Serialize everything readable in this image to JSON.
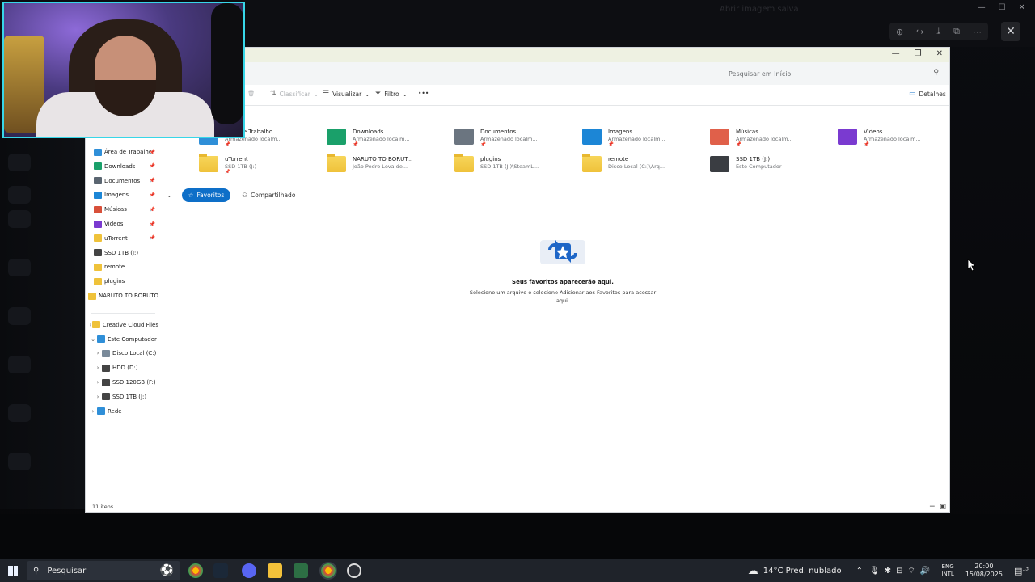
{
  "viewer": {
    "title": "Abrir imagem salva",
    "tool_icons": [
      "zoom-icon",
      "share-icon",
      "download-icon",
      "open-external-icon",
      "more-icon"
    ],
    "close_label": "✕"
  },
  "explorer": {
    "search_placeholder": "Pesquisar em Início",
    "toolbar": {
      "sort": "Classificar",
      "view": "Visualizar",
      "filter": "Filtro",
      "more": "•••",
      "details": "Detalhes"
    },
    "sidebar": {
      "pinned": [
        {
          "label": "Área de Trabalho",
          "color": "#2f8fd8",
          "pinned": true
        },
        {
          "label": "Downloads",
          "color": "#1aa06a",
          "pinned": true
        },
        {
          "label": "Documentos",
          "color": "#5a6570",
          "pinned": true
        },
        {
          "label": "Imagens",
          "color": "#1c86d6",
          "pinned": true
        },
        {
          "label": "Músicas",
          "color": "#d8503a",
          "pinned": true
        },
        {
          "label": "Vídeos",
          "color": "#7a3ad0",
          "pinned": true
        },
        {
          "label": "uTorrent",
          "color": "#efc23a",
          "pinned": true
        },
        {
          "label": "SSD 1TB (J:)",
          "color": "#444",
          "pinned": false
        },
        {
          "label": "remote",
          "color": "#efc23a",
          "pinned": false
        },
        {
          "label": "plugins",
          "color": "#efc23a",
          "pinned": false
        },
        {
          "label": "NARUTO TO BORUTO",
          "color": "#efc23a",
          "pinned": false
        }
      ],
      "tree": [
        {
          "label": "Creative Cloud Files",
          "color": "#efc23a",
          "level": 0,
          "chev": "›"
        },
        {
          "label": "Este Computador",
          "color": "#2f8fd8",
          "level": 0,
          "chev": "⌄"
        },
        {
          "label": "Disco Local (C:)",
          "color": "#7a8a9a",
          "level": 1,
          "chev": "›"
        },
        {
          "label": "HDD (D:)",
          "color": "#444",
          "level": 1,
          "chev": "›"
        },
        {
          "label": "SSD 120GB (F:)",
          "color": "#444",
          "level": 1,
          "chev": "›"
        },
        {
          "label": "SSD 1TB (J:)",
          "color": "#444",
          "level": 1,
          "chev": "›"
        },
        {
          "label": "Rede",
          "color": "#2f8fd8",
          "level": 0,
          "chev": "›"
        }
      ]
    },
    "quick_access": [
      {
        "title": "Área de Trabalho",
        "sub": "Armazenado localm...",
        "pin": "📌",
        "kind": "desktop"
      },
      {
        "title": "Downloads",
        "sub": "Armazenado localm...",
        "pin": "📌",
        "kind": "downloads"
      },
      {
        "title": "Documentos",
        "sub": "Armazenado localm...",
        "pin": "📌",
        "kind": "documents"
      },
      {
        "title": "Imagens",
        "sub": "Armazenado localm...",
        "pin": "📌",
        "kind": "images"
      },
      {
        "title": "Músicas",
        "sub": "Armazenado localm...",
        "pin": "📌",
        "kind": "music"
      },
      {
        "title": "Vídeos",
        "sub": "Armazenado localm...",
        "pin": "📌",
        "kind": "videos"
      },
      {
        "title": "uTorrent",
        "sub": "SSD 1TB (J:)",
        "pin": "📌",
        "kind": "folder"
      },
      {
        "title": "NARUTO TO BORUT...",
        "sub": "João Pedro Leva de...",
        "pin": "",
        "kind": "folder"
      },
      {
        "title": "plugins",
        "sub": "SSD 1TB (J:)\\SteamL...",
        "pin": "",
        "kind": "folder"
      },
      {
        "title": "remote",
        "sub": "Disco Local (C:)\\Arq...",
        "pin": "",
        "kind": "folder"
      },
      {
        "title": "SSD 1TB (J:)",
        "sub": "Este Computador",
        "pin": "",
        "kind": "drive"
      }
    ],
    "tabs": {
      "favorites": "Favoritos",
      "shared": "Compartilhado"
    },
    "empty": {
      "title": "Seus favoritos aparecerão aqui.",
      "desc": "Selecione um arquivo e selecione Adicionar aos Favoritos para acessar aqui."
    },
    "status": "11 itens"
  },
  "taskbar": {
    "search": "Pesquisar",
    "weather": "14°C  Pred. nublado",
    "lang1": "ENG",
    "lang2": "INTL",
    "time": "20:00",
    "date": "15/08/2025",
    "notif": "13"
  }
}
